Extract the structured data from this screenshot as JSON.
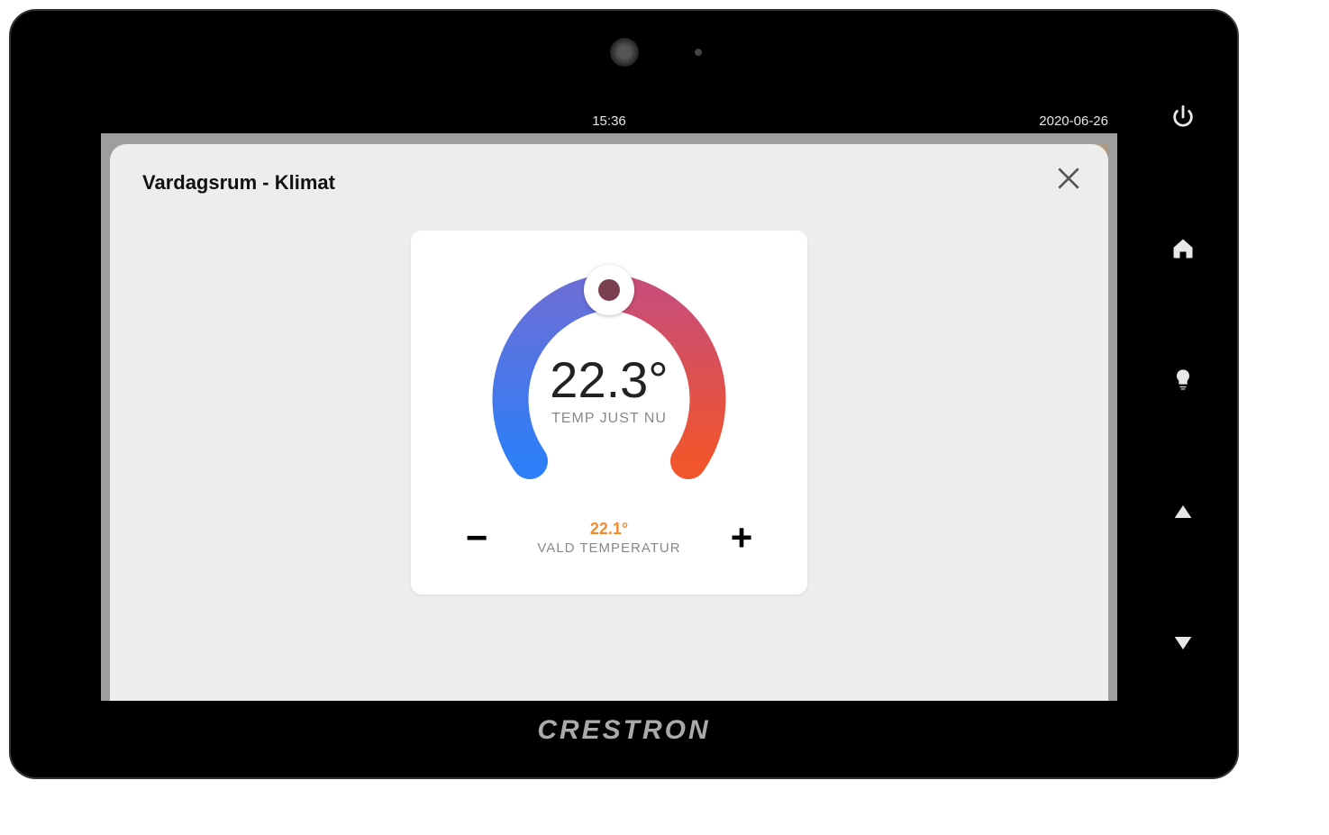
{
  "brand": "CRESTRON",
  "status": {
    "time": "15:36",
    "date": "2020-06-26"
  },
  "modal": {
    "title": "Vardagsrum - Klimat"
  },
  "thermostat": {
    "current_temp": "22.3°",
    "current_label": "TEMP JUST NU",
    "setpoint_temp": "22.1°",
    "setpoint_label": "VALD TEMPERATUR",
    "minus": "−",
    "plus": "+"
  },
  "colors": {
    "accent": "#f28b2e",
    "gauge_cold": "#2d7ef7",
    "gauge_warm": "#f0552b"
  },
  "chart_data": {
    "type": "gauge",
    "title": "Vardagsrum - Klimat",
    "current_value": 22.3,
    "setpoint_value": 22.1,
    "unit": "°",
    "range_approx": [
      15,
      30
    ],
    "color_scale": [
      "#2d7ef7",
      "#7a4fb0",
      "#f0552b"
    ]
  }
}
